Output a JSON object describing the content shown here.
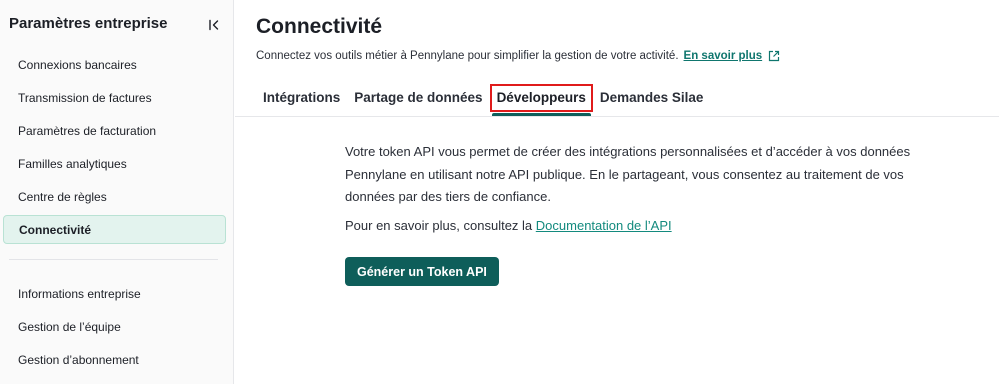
{
  "sidebar": {
    "title": "Paramètres entreprise",
    "collapse_icon": "collapse-left-icon",
    "items": [
      {
        "label": "Connexions bancaires"
      },
      {
        "label": "Transmission de factures"
      },
      {
        "label": "Paramètres de facturation"
      },
      {
        "label": "Familles analytiques"
      },
      {
        "label": "Centre de règles"
      },
      {
        "label": "Connectivité",
        "active": true
      }
    ],
    "items_secondary": [
      {
        "label": "Informations entreprise"
      },
      {
        "label": "Gestion de l’équipe"
      },
      {
        "label": "Gestion d’abonnement"
      }
    ]
  },
  "header": {
    "title": "Connectivité",
    "subtitle": "Connectez vos outils métier à Pennylane pour simplifier la gestion de votre activité.",
    "learn_more": "En savoir plus",
    "learn_more_icon": "external-link-icon"
  },
  "tabs": [
    {
      "label": "Intégrations"
    },
    {
      "label": "Partage de données"
    },
    {
      "label": "Développeurs",
      "active": true,
      "highlighted": true
    },
    {
      "label": "Demandes Silae"
    }
  ],
  "developers": {
    "description": "Votre token API vous permet de créer des intégrations personnalisées et d’accéder à vos données Pennylane en utilisant notre API publique. En le partageant, vous consentez au traitement de vos données par des tiers de confiance.",
    "doc_prefix": "Pour en savoir plus, consultez la",
    "doc_link": "Documentation de l’API",
    "generate_button": "Générer un Token API"
  },
  "colors": {
    "primary": "#0e5e5a",
    "link": "#138a7e",
    "active_nav_bg": "#e3f3ee",
    "highlight": "#e01b1b"
  }
}
